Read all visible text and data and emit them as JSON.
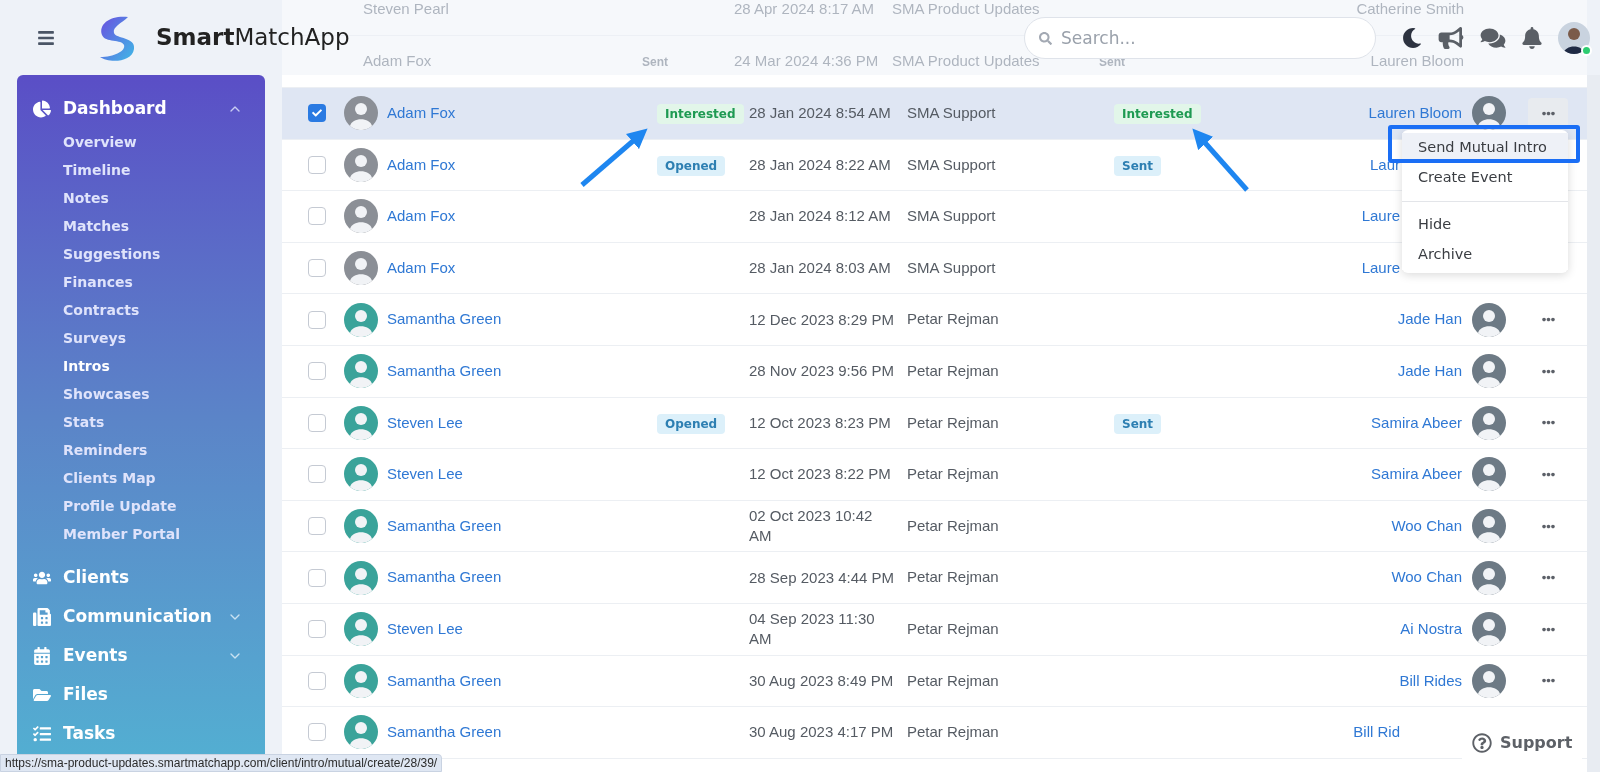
{
  "header": {
    "logo_text": "**Smart**MatchApp",
    "search": {
      "placeholder": "Search..."
    },
    "user": {
      "online": true
    }
  },
  "sidebar": {
    "sections": [
      {
        "label": "Dashboard",
        "kind": "chart",
        "expanded": true,
        "children": [
          {
            "label": "Overview",
            "selected": false
          },
          {
            "label": "Timeline",
            "selected": false
          },
          {
            "label": "Notes",
            "selected": false
          },
          {
            "label": "Matches",
            "selected": false
          },
          {
            "label": "Suggestions",
            "selected": false
          },
          {
            "label": "Finances",
            "selected": false
          },
          {
            "label": "Contracts",
            "selected": false
          },
          {
            "label": "Surveys",
            "selected": false
          },
          {
            "label": "Intros",
            "selected": true
          },
          {
            "label": "Showcases",
            "selected": false
          },
          {
            "label": "Stats",
            "selected": false
          },
          {
            "label": "Reminders",
            "selected": false
          },
          {
            "label": "Clients Map",
            "selected": false
          },
          {
            "label": "Profile Update",
            "selected": false
          },
          {
            "label": "Member Portal",
            "selected": false
          }
        ]
      },
      {
        "label": "Clients",
        "kind": "users"
      },
      {
        "label": "Communication",
        "kind": "phone",
        "expanded": false
      },
      {
        "label": "Events",
        "kind": "calendar",
        "expanded": false
      },
      {
        "label": "Files",
        "kind": "folder"
      },
      {
        "label": "Tasks",
        "kind": "tasks"
      }
    ]
  },
  "background_rows": [
    {
      "contact": "Steven Pearl",
      "date": "28 Apr 2024 8:17 AM",
      "sender": "SMA Product Updates",
      "recipient": "Catherine Smith"
    },
    {
      "contact": "Adam Fox",
      "status": "Sent",
      "date": "24 Mar 2024 4:36 PM",
      "sender": "SMA Product Updates",
      "response": "Sent",
      "recipient": "Lauren Bloom"
    }
  ],
  "rows": [
    {
      "checked": true,
      "selected": true,
      "contact": "Adam Fox",
      "status": {
        "text": "Interested",
        "kind": "success"
      },
      "date": "28 Jan 2024 8:54 AM",
      "sender": "SMA Support",
      "response": {
        "text": "Interested",
        "kind": "success"
      },
      "recipient": "Lauren Bloom",
      "recipient_visible": true,
      "menu_open": true
    },
    {
      "checked": false,
      "selected": false,
      "contact": "Adam Fox",
      "status": {
        "text": "Opened",
        "kind": "info"
      },
      "date": "28 Jan 2024 8:22 AM",
      "sender": "SMA Support",
      "response": {
        "text": "Sent",
        "kind": "info"
      },
      "recipient": "Laur",
      "recipient_visible": false
    },
    {
      "checked": false,
      "selected": false,
      "contact": "Adam Fox",
      "date": "28 Jan 2024 8:12 AM",
      "sender": "SMA Support",
      "recipient": "Laure",
      "recipient_visible": false
    },
    {
      "checked": false,
      "selected": false,
      "contact": "Adam Fox",
      "date": "28 Jan 2024 8:03 AM",
      "sender": "SMA Support",
      "recipient": "Laure",
      "recipient_visible": false
    },
    {
      "checked": false,
      "selected": false,
      "contact": "Samantha Green",
      "date": "12 Dec 2023 8:29 PM",
      "sender": "Petar Rejman",
      "recipient": "Jade Han",
      "recipient_visible": true,
      "menu_open": false
    },
    {
      "checked": false,
      "selected": false,
      "contact": "Samantha Green",
      "date": "28 Nov 2023 9:56 PM",
      "sender": "Petar Rejman",
      "recipient": "Jade Han",
      "recipient_visible": true,
      "menu_open": false
    },
    {
      "checked": false,
      "selected": false,
      "contact": "Steven Lee",
      "status": {
        "text": "Opened",
        "kind": "info"
      },
      "date": "12 Oct 2023 8:23 PM",
      "sender": "Petar Rejman",
      "response": {
        "text": "Sent",
        "kind": "info"
      },
      "recipient": "Samira Abeer",
      "recipient_visible": true,
      "menu_open": false
    },
    {
      "checked": false,
      "selected": false,
      "contact": "Steven Lee",
      "date": "12 Oct 2023 8:22 PM",
      "sender": "Petar Rejman",
      "recipient": "Samira Abeer",
      "recipient_visible": true,
      "menu_open": false
    },
    {
      "checked": false,
      "selected": false,
      "contact": "Samantha Green",
      "date": "02 Oct 2023 10:42 AM",
      "sender": "Petar Rejman",
      "recipient": "Woo Chan",
      "recipient_visible": true,
      "menu_open": false
    },
    {
      "checked": false,
      "selected": false,
      "contact": "Samantha Green",
      "date": "28 Sep 2023 4:44 PM",
      "sender": "Petar Rejman",
      "recipient": "Woo Chan",
      "recipient_visible": true,
      "menu_open": false
    },
    {
      "checked": false,
      "selected": false,
      "contact": "Steven Lee",
      "date": "04 Sep 2023 11:30 AM",
      "sender": "Petar Rejman",
      "recipient": "Ai Nostra",
      "recipient_visible": true,
      "menu_open": false
    },
    {
      "checked": false,
      "selected": false,
      "contact": "Samantha Green",
      "date": "30 Aug 2023 8:49 PM",
      "sender": "Petar Rejman",
      "recipient": "Bill Rides",
      "recipient_visible": true,
      "menu_open": false
    },
    {
      "checked": false,
      "selected": false,
      "contact": "Samantha Green",
      "date": "30 Aug 2023 4:17 PM",
      "sender": "Petar Rejman",
      "recipient": "Bill Rid",
      "recipient_visible": false
    }
  ],
  "row_menu": {
    "items": [
      {
        "kind": "item",
        "label": "Send Mutual Intro",
        "highlighted": true
      },
      {
        "kind": "item",
        "label": "Create Event",
        "highlighted": false
      },
      {
        "kind": "divider"
      },
      {
        "kind": "item",
        "label": "Hide",
        "highlighted": false
      },
      {
        "kind": "item",
        "label": "Archive",
        "highlighted": false
      }
    ]
  },
  "support_button": {
    "label": "Support"
  },
  "status_url": "https://sma-product-updates.smartmatchapp.com/client/intro/mutual/create/28/39/"
}
